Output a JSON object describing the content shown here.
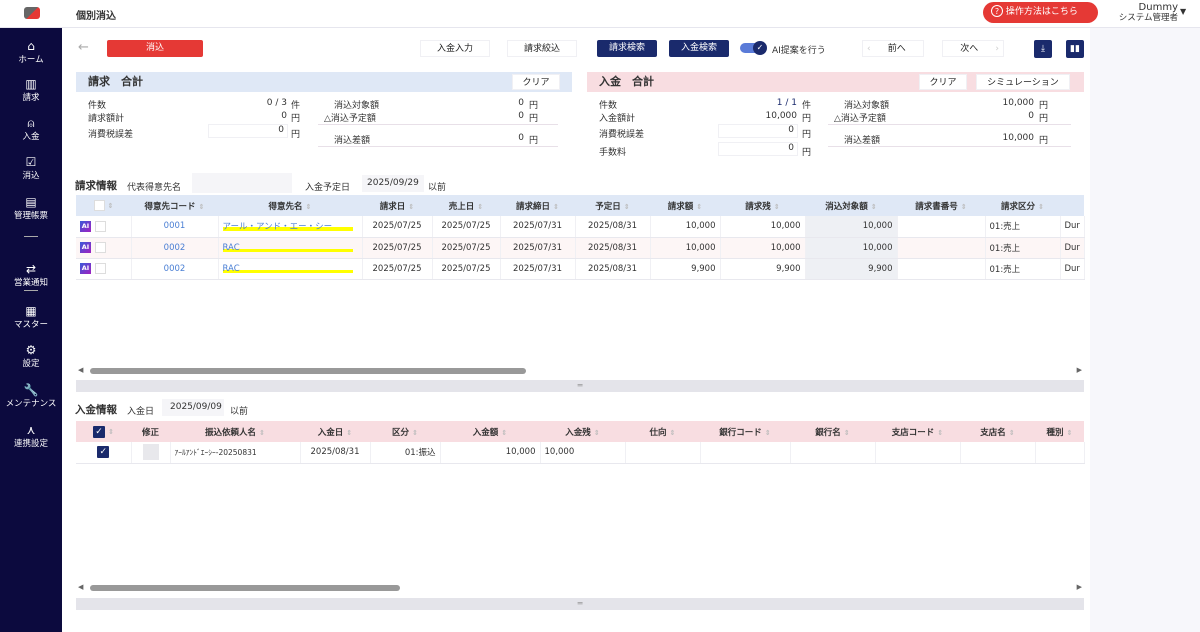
{
  "header": {
    "title": "個別消込",
    "help_label": "操作方法はこちら",
    "user_name": "Dummy",
    "user_role": "システム管理者"
  },
  "sidebar": {
    "items": [
      {
        "label": "ホーム",
        "icon": "home-icon",
        "glyph": "⌂"
      },
      {
        "label": "請求",
        "icon": "book-icon",
        "glyph": "▥"
      },
      {
        "label": "入金",
        "icon": "deposit-icon",
        "glyph": "⍝"
      },
      {
        "label": "消込",
        "icon": "checkbox-icon",
        "glyph": "☑"
      },
      {
        "label": "管理帳票",
        "icon": "report-icon",
        "glyph": "▤"
      },
      {
        "label": "営業通知",
        "icon": "notify-icon",
        "glyph": "⇄"
      },
      {
        "label": "マスター",
        "icon": "master-icon",
        "glyph": "▦"
      },
      {
        "label": "設定",
        "icon": "gear-icon",
        "glyph": "⚙"
      },
      {
        "label": "メンテナンス",
        "icon": "wrench-icon",
        "glyph": "🔧"
      },
      {
        "label": "連携設定",
        "icon": "network-icon",
        "glyph": "⋏"
      }
    ]
  },
  "toolbar": {
    "reconcile_label": "消込",
    "deposit_input_label": "入金入力",
    "invoice_filter_label": "請求絞込",
    "invoice_search_label": "請求検索",
    "deposit_search_label": "入金検索",
    "ai_toggle_label": "AI提案を行う",
    "ai_toggle_on": true,
    "prev_label": "前へ",
    "next_label": "次へ"
  },
  "invoice_summary": {
    "title": "請求　合計",
    "clear_label": "クリア",
    "count_label": "件数",
    "count_value": "0 / 3",
    "count_unit": "件",
    "total_label": "請求額計",
    "total_value": "0",
    "yen": "円",
    "tax_label": "消費税誤差",
    "tax_value": "0",
    "target_label": "消込対象額",
    "target_value": "0",
    "planned_label": "△消込予定額",
    "planned_value": "0",
    "diff_label": "消込差額",
    "diff_value": "0"
  },
  "deposit_summary": {
    "title": "入金　合計",
    "clear_label": "クリア",
    "simulation_label": "シミュレーション",
    "count_label": "件数",
    "count_value": "1 / 1",
    "count_unit": "件",
    "total_label": "入金額計",
    "total_value": "10,000",
    "yen": "円",
    "tax_label": "消費税誤差",
    "tax_value": "0",
    "fee_label": "手数料",
    "fee_value": "0",
    "target_label": "消込対象額",
    "target_value": "10,000",
    "planned_label": "△消込予定額",
    "planned_value": "0",
    "diff_label": "消込差額",
    "diff_value": "10,000"
  },
  "invoice_info": {
    "title": "請求情報",
    "rep_customer_label": "代表得意先名",
    "rep_customer_value": "",
    "due_label": "入金予定日",
    "due_value": "2025/09/29",
    "before_label": "以前",
    "columns": [
      "",
      "得意先コード",
      "得意先名",
      "請求日",
      "売上日",
      "請求締日",
      "予定日",
      "請求額",
      "請求残",
      "消込対象額",
      "請求書番号",
      "請求区分",
      ""
    ],
    "rows": [
      [
        "0001",
        "アール・アンド・エー・シー",
        "2025/07/25",
        "2025/07/25",
        "2025/07/31",
        "2025/08/31",
        "10,000",
        "10,000",
        "10,000",
        "",
        "01:売上",
        "Dur"
      ],
      [
        "0002",
        "RAC",
        "2025/07/25",
        "2025/07/25",
        "2025/07/31",
        "2025/08/31",
        "10,000",
        "10,000",
        "10,000",
        "",
        "01:売上",
        "Dur"
      ],
      [
        "0002",
        "RAC",
        "2025/07/25",
        "2025/07/25",
        "2025/07/31",
        "2025/08/31",
        "9,900",
        "9,900",
        "9,900",
        "",
        "01:売上",
        "Dur"
      ]
    ]
  },
  "deposit_info": {
    "title": "入金情報",
    "date_label": "入金日",
    "date_value": "2025/09/09",
    "before_label": "以前",
    "columns": [
      "",
      "修正",
      "振込依頼人名",
      "入金日",
      "区分",
      "入金額",
      "入金残",
      "仕向",
      "銀行コード",
      "銀行名",
      "支店コード",
      "支店名",
      "種別"
    ],
    "rows": [
      [
        "ｱｰﾙｱﾝﾄﾞｴｰｼｰ-20250831",
        "2025/08/31",
        "01:振込",
        "10,000",
        "10,000",
        "",
        "",
        "",
        "",
        "",
        ""
      ]
    ]
  },
  "colors": {
    "sidebar": "#0c0a3e",
    "navy": "#1a2a6c",
    "danger": "#e53935",
    "invoice_band": "#dfe8f6",
    "deposit_band": "#f8dde1",
    "highlight": "#ffff00"
  }
}
